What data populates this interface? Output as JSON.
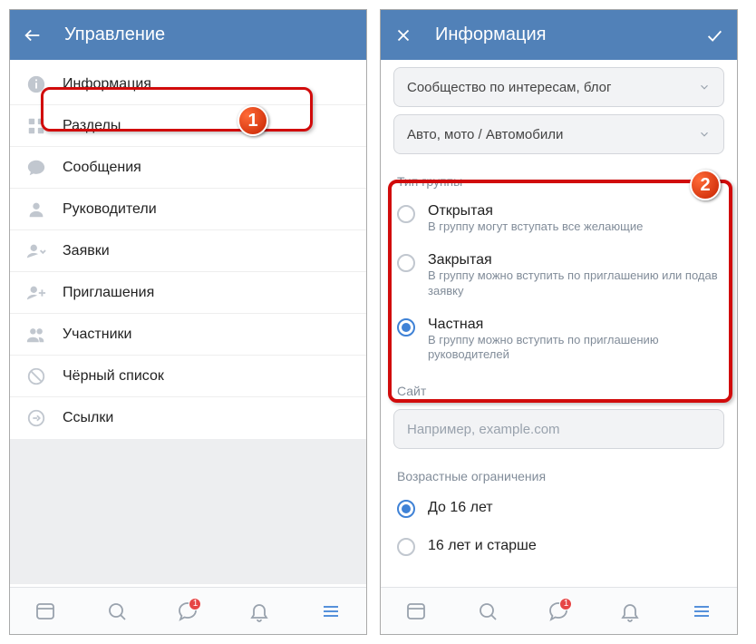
{
  "left": {
    "header": {
      "title": "Управление"
    },
    "menu": [
      {
        "label": "Информация"
      },
      {
        "label": "Разделы"
      },
      {
        "label": "Сообщения"
      },
      {
        "label": "Руководители"
      },
      {
        "label": "Заявки"
      },
      {
        "label": "Приглашения"
      },
      {
        "label": "Участники"
      },
      {
        "label": "Чёрный список"
      },
      {
        "label": "Ссылки"
      }
    ]
  },
  "right": {
    "header": {
      "title": "Информация"
    },
    "dropdown1": "Сообщество по интересам, блог",
    "dropdown2": "Авто, мото / Автомобили",
    "group_type_label": "Тип группы",
    "types": [
      {
        "title": "Открытая",
        "desc": "В группу могут вступать все желающие",
        "checked": false
      },
      {
        "title": "Закрытая",
        "desc": "В группу можно вступить по приглашению или подав заявку",
        "checked": false
      },
      {
        "title": "Частная",
        "desc": "В группу можно вступить по приглашению руководителей",
        "checked": true
      }
    ],
    "site_label": "Сайт",
    "site_placeholder": "Например, example.com",
    "age_label": "Возрастные ограничения",
    "age_options": [
      {
        "label": "До 16 лет",
        "checked": true
      },
      {
        "label": "16 лет и старше",
        "checked": false
      }
    ]
  },
  "tabbar": {
    "notif": "1"
  },
  "badges": {
    "one": "1",
    "two": "2"
  }
}
